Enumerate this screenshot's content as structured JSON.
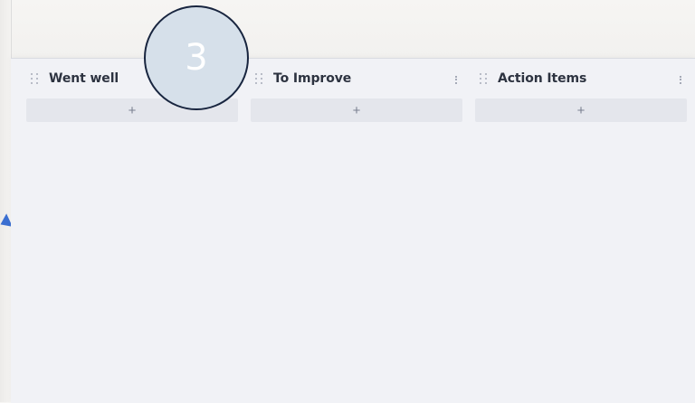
{
  "board": {
    "columns": [
      {
        "title": "Went well",
        "add_label": "+"
      },
      {
        "title": "To Improve",
        "add_label": "+"
      },
      {
        "title": "Action Items",
        "add_label": "+"
      }
    ]
  },
  "overlay": {
    "step_number": "3"
  },
  "colors": {
    "board_background": "#f1f2f6",
    "add_button": "#e4e6ec",
    "badge_fill": "#d6e0ea",
    "badge_border": "#18253f",
    "marker": "#3b6fd1"
  },
  "icons": {
    "drag_handle": "drag-handle-icon",
    "more": "more-vertical-icon",
    "add": "plus-icon"
  }
}
